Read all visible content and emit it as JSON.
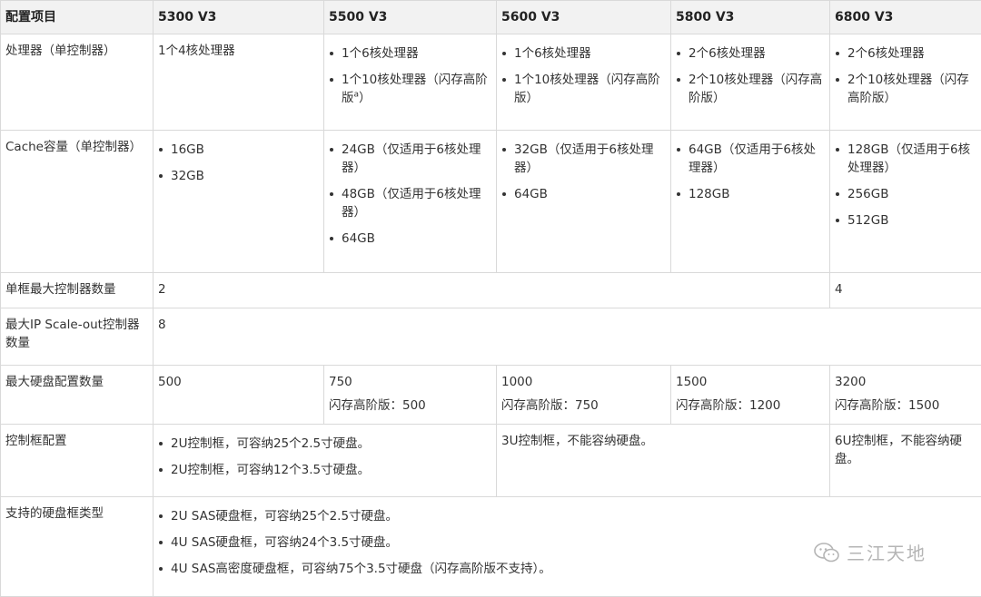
{
  "headers": [
    "配置项目",
    "5300 V3",
    "5500 V3",
    "5600 V3",
    "5800 V3",
    "6800 V3"
  ],
  "rows": {
    "cpu": {
      "label": "处理器（单控制器）",
      "c5300": "1个4核处理器",
      "c5500": [
        "1个6核处理器",
        "1个10核处理器（闪存高阶版",
        "a",
        "）"
      ],
      "c5600": [
        "1个6核处理器",
        "1个10核处理器（闪存高阶版）"
      ],
      "c5800": [
        "2个6核处理器",
        "2个10核处理器（闪存高阶版）"
      ],
      "c6800": [
        "2个6核处理器",
        "2个10核处理器（闪存高阶版）"
      ]
    },
    "cache": {
      "label": "Cache容量（单控制器）",
      "c5300": [
        "16GB",
        "32GB"
      ],
      "c5500": [
        "24GB（仅适用于6核处理器）",
        "48GB（仅适用于6核处理器）",
        "64GB"
      ],
      "c5600": [
        "32GB（仅适用于6核处理器）",
        "64GB"
      ],
      "c5800": [
        "64GB（仅适用于6核处理器）",
        "128GB"
      ],
      "c6800": [
        "128GB（仅适用于6核处理器）",
        "256GB",
        "512GB"
      ]
    },
    "max_ctrl": {
      "label": "单框最大控制器数量",
      "v1": "2",
      "v2": "4"
    },
    "scaleout": {
      "label": "最大IP Scale-out控制器数量",
      "v": "8"
    },
    "disks": {
      "label": "最大硬盘配置数量",
      "c5300": "500",
      "c5500": [
        "750",
        "闪存高阶版：500"
      ],
      "c5600": [
        "1000",
        "闪存高阶版：750"
      ],
      "c5800": [
        "1500",
        "闪存高阶版：1200"
      ],
      "c6800": [
        "3200",
        "闪存高阶版：1500"
      ]
    },
    "enclosure": {
      "label": "控制框配置",
      "a": [
        "2U控制框，可容纳25个2.5寸硬盘。",
        "2U控制框，可容纳12个3.5寸硬盘。"
      ],
      "b": "3U控制框，不能容纳硬盘。",
      "c": "6U控制框，不能容纳硬盘。"
    },
    "diskframe": {
      "label": "支持的硬盘框类型",
      "items": [
        "2U SAS硬盘框，可容纳25个2.5寸硬盘。",
        "4U SAS硬盘框，可容纳24个3.5寸硬盘。",
        "4U SAS高密度硬盘框，可容纳75个3.5寸硬盘（闪存高阶版不支持）。"
      ]
    }
  },
  "watermark": {
    "text": "三江天地",
    "icon": "wechat-icon"
  }
}
